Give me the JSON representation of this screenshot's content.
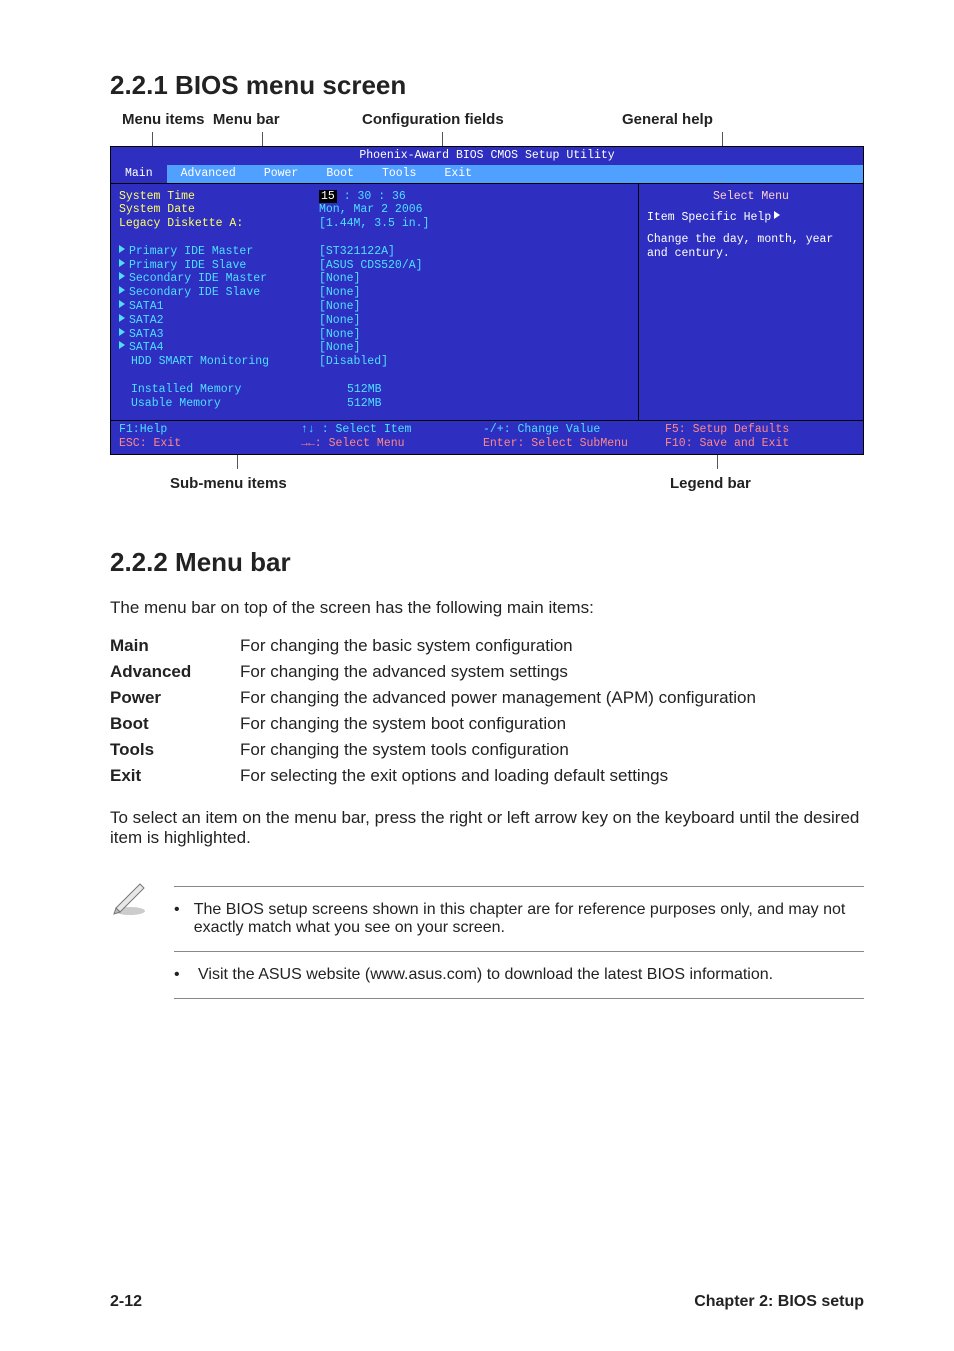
{
  "sections": {
    "s1_title": "2.2.1   BIOS menu screen",
    "s2_title": "2.2.2   Menu bar"
  },
  "top_labels": {
    "menu_items": "Menu items",
    "menu_bar": "Menu bar",
    "config_fields": "Configuration fields",
    "general_help": "General help"
  },
  "bios": {
    "title": "Phoenix-Award BIOS CMOS Setup Utility",
    "tabs": [
      "Main",
      "Advanced",
      "Power",
      "Boot",
      "Tools",
      "Exit"
    ],
    "left": {
      "sys_time_label": "System Time",
      "sys_time_val_hh": "15",
      "sys_time_val_rest": " : 30 : 36",
      "sys_date_label": "System Date",
      "sys_date_val": "Mon, Mar 2  2006",
      "legacy_label": "Legacy Diskette A:",
      "legacy_val": "[1.44M, 3.5 in.]",
      "pim_label": "Primary IDE Master",
      "pim_val": "[ST321122A]",
      "pis_label": "Primary IDE Slave",
      "pis_val": "[ASUS CDS520/A]",
      "sim_label": "Secondary IDE Master",
      "sim_val": "[None]",
      "sis_label": "Secondary IDE Slave",
      "sis_val": "[None]",
      "sata1_label": "SATA1",
      "sata1_val": "[None]",
      "sata2_label": "SATA2",
      "sata2_val": "[None]",
      "sata3_label": "SATA3",
      "sata3_val": "[None]",
      "sata4_label": "SATA4",
      "sata4_val": "[None]",
      "hdd_label": "HDD SMART Monitoring",
      "hdd_val": "[Disabled]",
      "inst_label": "Installed Memory",
      "inst_val": "512MB",
      "usable_label": "Usable Memory",
      "usable_val": "512MB"
    },
    "right": {
      "select_menu": "Select Menu",
      "ish": "Item Specific Help",
      "help_text": "Change the day, month, year and century."
    },
    "legend": {
      "f1": "F1:Help",
      "esc": "ESC: Exit",
      "sel_item": "↑↓ : Select Item",
      "sel_menu": "→←: Select Menu",
      "change": "-/+: Change Value",
      "enter": "Enter: Select SubMenu",
      "f5": "F5: Setup Defaults",
      "f10": "F10: Save and Exit"
    }
  },
  "bottom_labels": {
    "submenu": "Sub-menu items",
    "legend_bar": "Legend bar"
  },
  "menubar": {
    "intro": "The menu bar on top of the screen has the following main items:",
    "items": [
      {
        "name": "Main",
        "desc": "For changing the basic system configuration"
      },
      {
        "name": "Advanced",
        "desc": "For changing the advanced system settings"
      },
      {
        "name": "Power",
        "desc": "For changing the advanced power management (APM) configuration"
      },
      {
        "name": "Boot",
        "desc": "For changing the system boot configuration"
      },
      {
        "name": "Tools",
        "desc": "For changing the system tools configuration"
      },
      {
        "name": "Exit",
        "desc": "For selecting the exit options and loading default settings"
      }
    ],
    "select_note": "To select an item on the menu bar, press the right or left arrow key on the keyboard until the desired item is highlighted."
  },
  "notes": {
    "n1": "The BIOS setup screens shown in this chapter are for reference purposes only, and may not exactly match what you see on your screen.",
    "n2": "Visit the ASUS website (www.asus.com) to download the latest BIOS information."
  },
  "footer": {
    "left": "2-12",
    "right": "Chapter 2: BIOS setup"
  }
}
